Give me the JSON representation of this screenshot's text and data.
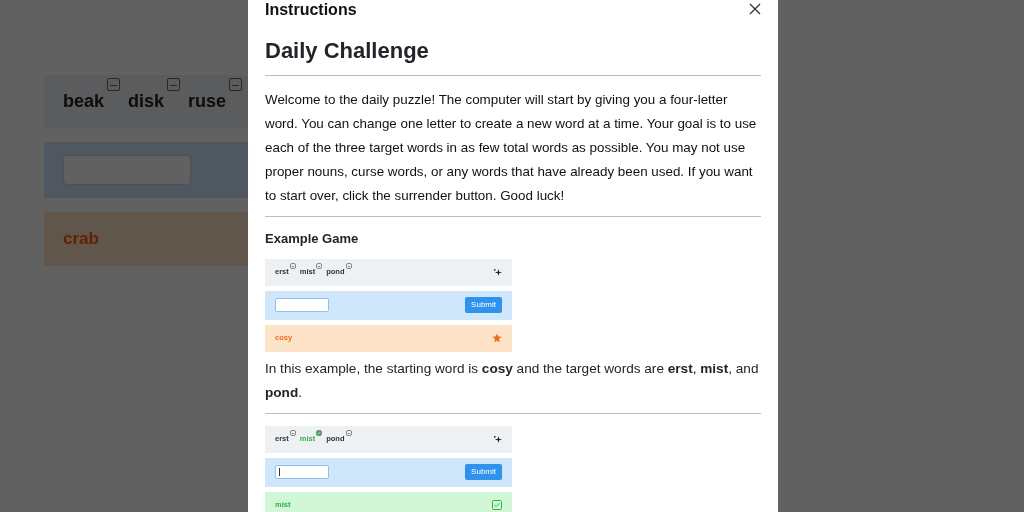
{
  "game": {
    "targets": [
      {
        "word": "beak",
        "found": false
      },
      {
        "word": "disk",
        "found": false
      },
      {
        "word": "ruse",
        "found": false
      }
    ],
    "history": [
      {
        "word": "crab",
        "kind": "start"
      }
    ]
  },
  "modal": {
    "title": "Instructions",
    "heading": "Daily Challenge",
    "intro": "Welcome to the daily puzzle! The computer will start by giving you a four-letter word. You can change one letter to create a new word at a time. Your goal is to use each of the three target words in as few total words as possible. You may not use proper nouns, curse words, or any words that have already been used. If you want to start over, click the surrender button. Good luck!",
    "subheading": "Example Game",
    "sections": [
      {
        "kind": "game",
        "targets": [
          {
            "word": "erst",
            "found": false
          },
          {
            "word": "mist",
            "found": false
          },
          {
            "word": "pond",
            "found": false
          }
        ],
        "submit": "Submit",
        "cursor": false,
        "rows": [
          {
            "word": "cosy",
            "kind": "start"
          }
        ]
      },
      {
        "kind": "caption",
        "text": "In this example, the starting word is **cosy** and the target words are **erst**, **mist**, and **pond**."
      },
      {
        "kind": "game",
        "targets": [
          {
            "word": "erst",
            "found": false
          },
          {
            "word": "mist",
            "found": true
          },
          {
            "word": "pond",
            "found": false
          }
        ],
        "submit": "Submit",
        "cursor": true,
        "rows": [
          {
            "word": "mist",
            "kind": "hit"
          }
        ]
      }
    ]
  }
}
